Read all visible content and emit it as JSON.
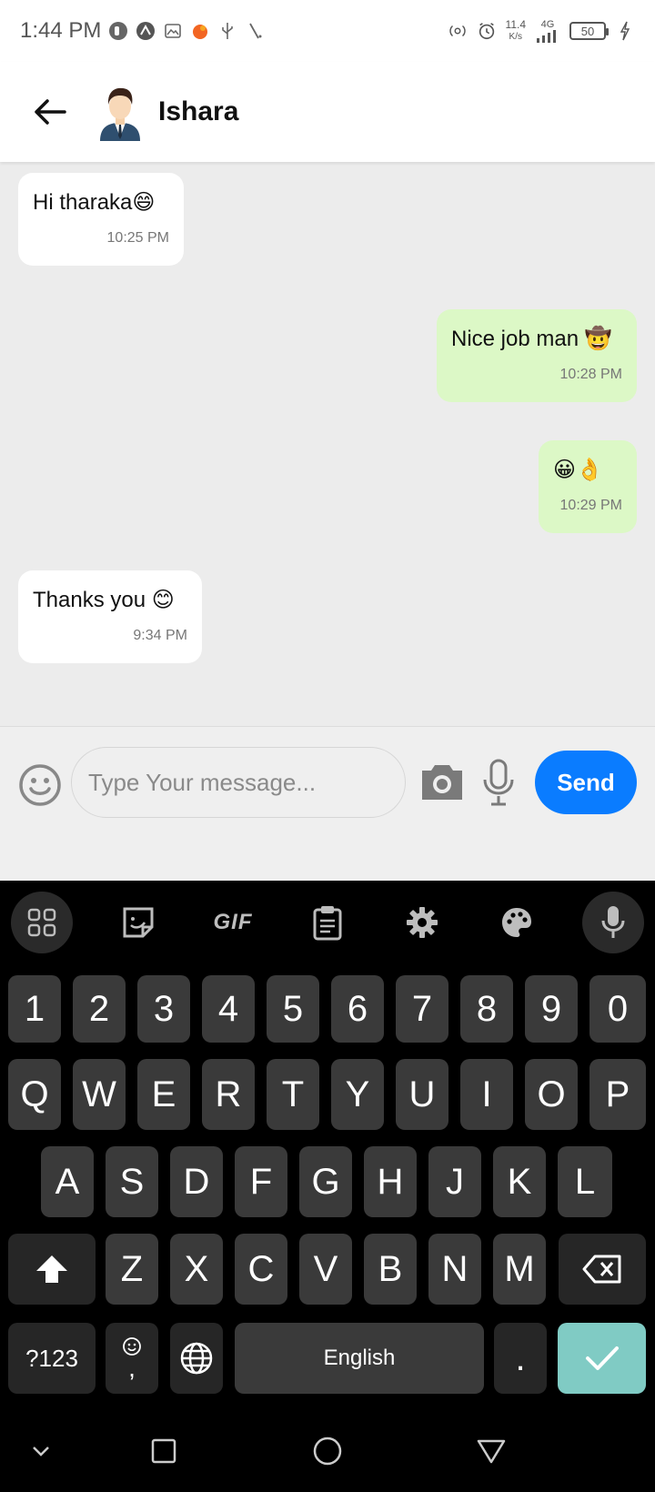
{
  "status_bar": {
    "time": "1:44 PM",
    "net_speed_value": "11.4",
    "net_speed_unit": "K/s",
    "network": "4G",
    "battery": "50"
  },
  "header": {
    "contact_name": "Ishara"
  },
  "messages": [
    {
      "direction": "in",
      "text": "Hi tharaka😄",
      "time": "10:25 PM"
    },
    {
      "direction": "out",
      "text": "Nice job man 🤠",
      "time": "10:28 PM"
    },
    {
      "direction": "out",
      "text": "😀👌",
      "time": "10:29 PM"
    },
    {
      "direction": "in",
      "text": "Thanks you 😊",
      "time": "9:34 PM"
    }
  ],
  "composer": {
    "placeholder": "Type Your message...",
    "send_label": "Send"
  },
  "keyboard": {
    "toolbar_gif": "GIF",
    "number_row": [
      "1",
      "2",
      "3",
      "4",
      "5",
      "6",
      "7",
      "8",
      "9",
      "0"
    ],
    "row1": [
      "Q",
      "W",
      "E",
      "R",
      "T",
      "Y",
      "U",
      "I",
      "O",
      "P"
    ],
    "row2": [
      "A",
      "S",
      "D",
      "F",
      "G",
      "H",
      "J",
      "K",
      "L"
    ],
    "row3": [
      "Z",
      "X",
      "C",
      "V",
      "B",
      "N",
      "M"
    ],
    "symbols_label": "?123",
    "comma": ",",
    "space_label": "English",
    "period": "."
  },
  "colors": {
    "incoming_bubble": "#ffffff",
    "outgoing_bubble": "#dcf8c6",
    "send_button": "#0a7cff",
    "keyboard_bg": "#000000",
    "key_bg": "#3a3a3a",
    "confirm_key": "#80cbc4"
  }
}
